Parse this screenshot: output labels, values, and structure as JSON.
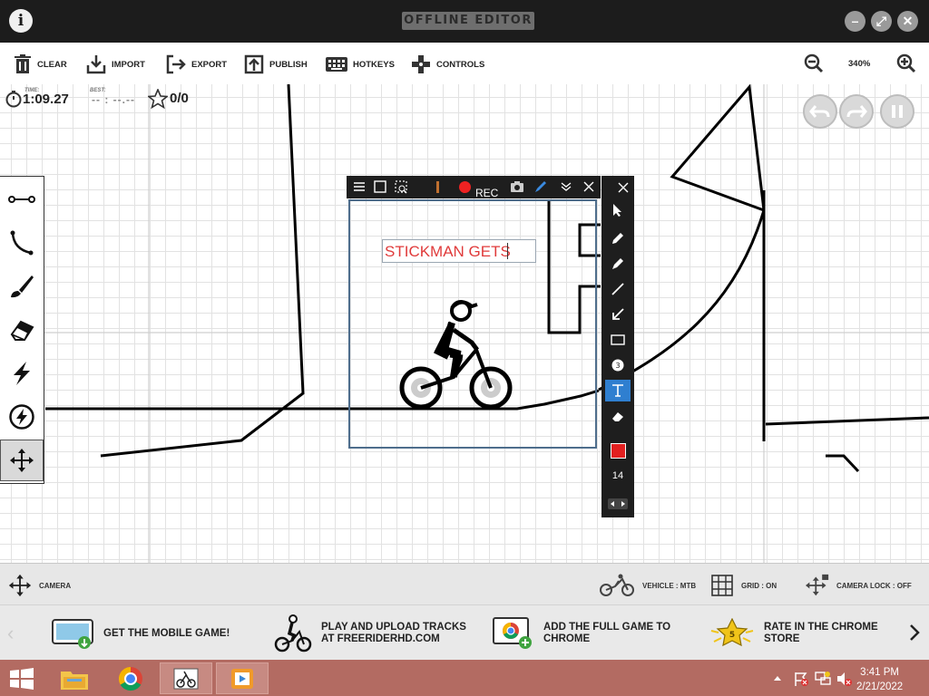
{
  "window": {
    "title": "OFFLINE EDITOR",
    "info_label": "i",
    "minimize_label": "–",
    "maximize_label": "⤢",
    "close_label": "✕"
  },
  "toolbar": {
    "clear": "CLEAR",
    "import": "IMPORT",
    "export": "EXPORT",
    "publish": "PUBLISH",
    "hotkeys": "HOTKEYS",
    "controls": "CONTROLS",
    "zoom": "340%"
  },
  "hud": {
    "time_label": "TIME:",
    "time_value": "1:09.27",
    "best_label": "BEST:",
    "best_value": "-- : --.--",
    "stars": "0/0"
  },
  "left_tools": [
    {
      "icon": "straight-line-icon"
    },
    {
      "icon": "curve-icon"
    },
    {
      "icon": "brush-icon"
    },
    {
      "icon": "eraser-icon"
    },
    {
      "icon": "boost-icon"
    },
    {
      "icon": "powerup-icon"
    },
    {
      "icon": "move-camera-icon",
      "active": true
    }
  ],
  "recorder": {
    "rec_label": "REC",
    "text_value": "STICKMAN GETS ",
    "palette_color": "#e32020",
    "font_size": "14"
  },
  "status_bar": {
    "camera": "CAMERA",
    "vehicle": "VEHICLE : MTB",
    "grid": "GRID : ON",
    "camera_lock": "CAMERA LOCK : OFF"
  },
  "promos": [
    {
      "text": "GET THE MOBILE GAME!"
    },
    {
      "line1": "PLAY AND UPLOAD TRACKS",
      "line2": "AT FREERIDERHD.COM"
    },
    {
      "line1": "ADD THE FULL GAME TO",
      "line2": "CHROME"
    },
    {
      "line1": "RATE IN THE CHROME",
      "line2": "STORE"
    }
  ],
  "taskbar": {
    "time": "3:41 PM",
    "date": "2/21/2022"
  },
  "colors": {
    "titlebar": "#1c1c1c",
    "taskbar": "#b36b62",
    "accent_blue": "#2f7fd0",
    "text_red": "#e03b3b"
  }
}
